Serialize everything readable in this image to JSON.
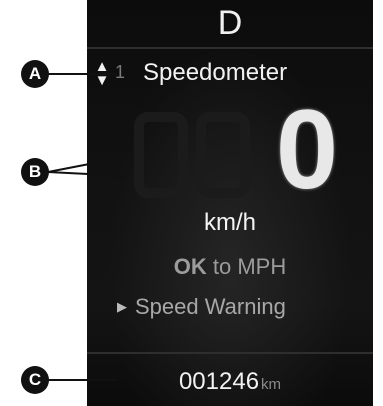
{
  "cluster": {
    "gear": "D",
    "menu": {
      "up_down_arrows": "▲▼",
      "index": "1",
      "title": "Speedometer"
    },
    "speed": {
      "value": "0",
      "unit": "km/h"
    },
    "hint": {
      "key": "OK",
      "action": "to MPH"
    },
    "sub_menu": {
      "arrow": "▶",
      "label": "Speed Warning"
    },
    "odometer": {
      "value": "001246",
      "unit": "km"
    }
  },
  "callouts": {
    "a": "A",
    "b": "B",
    "c": "C"
  }
}
